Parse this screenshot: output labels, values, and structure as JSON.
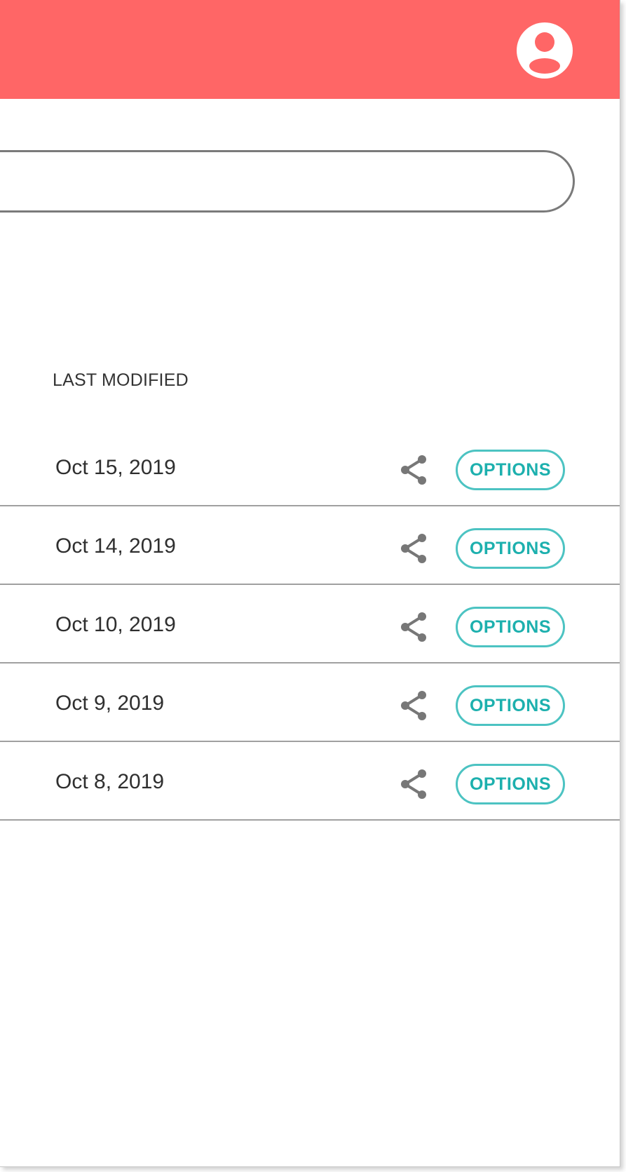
{
  "colors": {
    "topbar": "#ff6666",
    "accent": "#4cc3c2",
    "accent_text": "#1db0ae",
    "divider": "#a0a0a0",
    "icon": "#777777"
  },
  "header": {
    "avatar_icon": "user-avatar-icon"
  },
  "search": {
    "value": "",
    "placeholder": ""
  },
  "table": {
    "column_header": "LAST MODIFIED",
    "rows": [
      {
        "date": "Oct 15, 2019",
        "share_icon": "share-icon",
        "options_label": "OPTIONS"
      },
      {
        "date": "Oct 14, 2019",
        "share_icon": "share-icon",
        "options_label": "OPTIONS"
      },
      {
        "date": "Oct 10, 2019",
        "share_icon": "share-icon",
        "options_label": "OPTIONS"
      },
      {
        "date": "Oct 9, 2019",
        "share_icon": "share-icon",
        "options_label": "OPTIONS"
      },
      {
        "date": "Oct 8, 2019",
        "share_icon": "share-icon",
        "options_label": "OPTIONS"
      }
    ]
  }
}
